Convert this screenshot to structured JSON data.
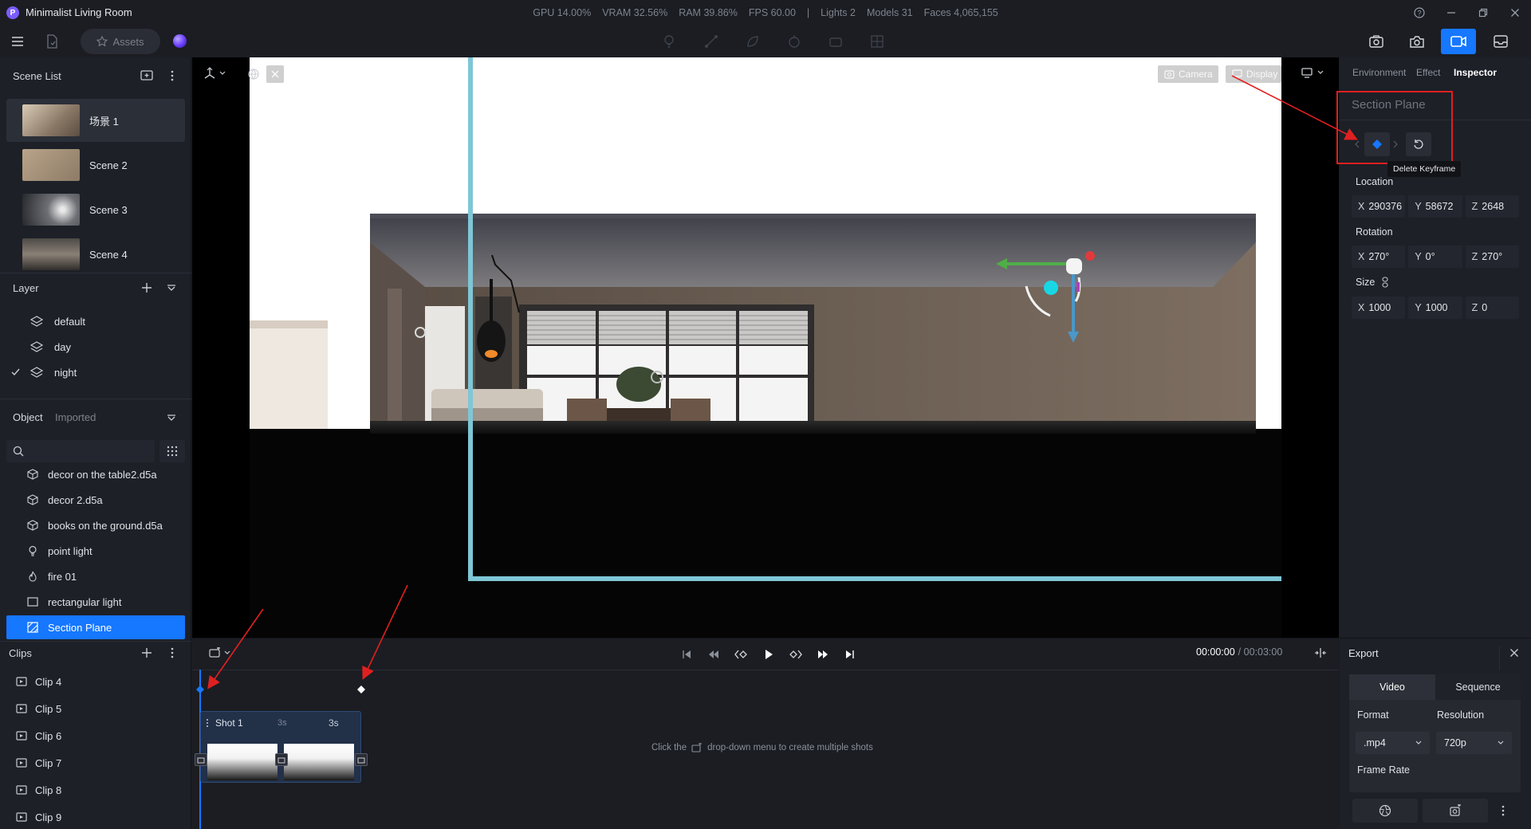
{
  "app": {
    "title": "Minimalist Living Room",
    "logo": "P",
    "stats": [
      "GPU 14.00%",
      "VRAM 32.56%",
      "RAM 39.86%",
      "FPS 60.00",
      "|",
      "Lights 2",
      "Models 31",
      "Faces 4,065,155"
    ]
  },
  "toolbar": {
    "assets_label": "Assets"
  },
  "scene_list": {
    "title": "Scene List",
    "scenes": [
      {
        "label": "场景 1",
        "selected": true
      },
      {
        "label": "Scene 2",
        "selected": false
      },
      {
        "label": "Scene 3",
        "selected": false
      },
      {
        "label": "Scene 4",
        "selected": false
      }
    ]
  },
  "layers": {
    "title": "Layer",
    "items": [
      {
        "label": "default",
        "checked": false
      },
      {
        "label": "day",
        "checked": false
      },
      {
        "label": "night",
        "checked": true
      }
    ]
  },
  "objects": {
    "tab_object": "Object",
    "tab_imported": "Imported",
    "items": [
      {
        "label": "decor on the table2.d5a",
        "icon": "cube-icon"
      },
      {
        "label": "decor 2.d5a",
        "icon": "cube-icon"
      },
      {
        "label": "books on the ground.d5a",
        "icon": "cube-icon"
      },
      {
        "label": "point light",
        "icon": "bulb-icon"
      },
      {
        "label": "fire 01",
        "icon": "flame-icon"
      },
      {
        "label": "rectangular light",
        "icon": "rect-light-icon"
      },
      {
        "label": "Section Plane",
        "icon": "section-plane-icon",
        "selected": true
      }
    ]
  },
  "clips": {
    "title": "Clips",
    "items": [
      "Clip 4",
      "Clip 5",
      "Clip 6",
      "Clip 7",
      "Clip 8",
      "Clip 9"
    ]
  },
  "viewport": {
    "camera_label": "Camera",
    "display_label": "Display"
  },
  "inspector": {
    "tabs": [
      "Environment",
      "Effect",
      "Inspector"
    ],
    "active_tab": "Inspector",
    "section_title": "Section Plane",
    "tooltip": "Delete Keyframe",
    "location_label": "Location",
    "location": {
      "x": "290376",
      "y": "58672",
      "z": "2648"
    },
    "rotation_label": "Rotation",
    "rotation": {
      "x": "270°",
      "y": "0°",
      "z": "270°"
    },
    "size_label": "Size",
    "size": {
      "x": "1000",
      "y": "1000",
      "z": "0"
    }
  },
  "timeline": {
    "time_current": "00:00:00",
    "time_total": "/ 00:03:00",
    "shot_label": "Shot 1",
    "shot_dur_a": "3s",
    "shot_dur_b": "3s",
    "hint_prefix": "Click the",
    "hint_suffix": "drop-down menu to create multiple shots"
  },
  "export": {
    "title": "Export",
    "tab_video": "Video",
    "tab_sequence": "Sequence",
    "format_label": "Format",
    "format_value": ".mp4",
    "resolution_label": "Resolution",
    "resolution_value": "720p",
    "frame_rate_label": "Frame Rate"
  },
  "colors": {
    "accent": "#1677ff",
    "annotation": "#e02020",
    "section_line": "#7ec6d6"
  }
}
